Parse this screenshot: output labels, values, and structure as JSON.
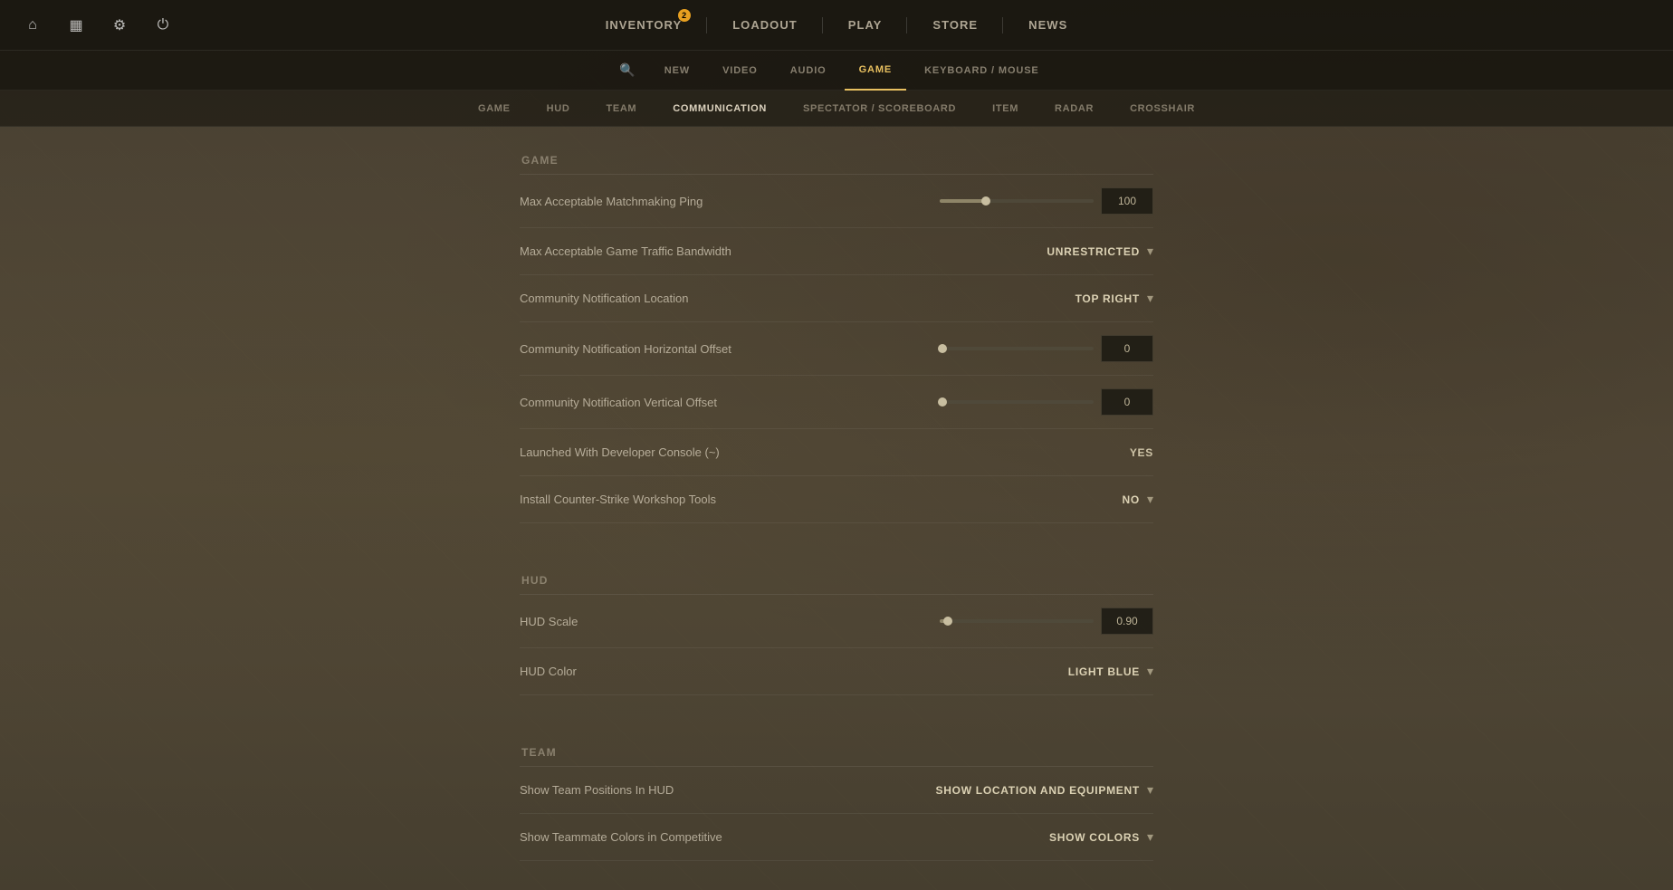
{
  "topNav": {
    "icons": [
      {
        "name": "home-icon",
        "symbol": "⌂"
      },
      {
        "name": "display-icon",
        "symbol": "▦"
      },
      {
        "name": "settings-icon",
        "symbol": "⚙"
      },
      {
        "name": "power-icon",
        "symbol": "⏻"
      }
    ],
    "links": [
      {
        "label": "INVENTORY",
        "badge": "2",
        "active": false
      },
      {
        "label": "LOADOUT",
        "badge": null,
        "active": false
      },
      {
        "label": "PLAY",
        "badge": null,
        "active": false
      },
      {
        "label": "STORE",
        "badge": null,
        "active": false
      },
      {
        "label": "NEWS",
        "badge": null,
        "active": false
      }
    ]
  },
  "secondaryNav": {
    "searchPlaceholder": "Search",
    "links": [
      {
        "label": "NEW",
        "active": false
      },
      {
        "label": "VIDEO",
        "active": false
      },
      {
        "label": "AUDIO",
        "active": false
      },
      {
        "label": "GAME",
        "active": true
      },
      {
        "label": "KEYBOARD / MOUSE",
        "active": false
      }
    ]
  },
  "thirdNav": {
    "links": [
      {
        "label": "GAME",
        "active": false
      },
      {
        "label": "HUD",
        "active": false
      },
      {
        "label": "TEAM",
        "active": false
      },
      {
        "label": "COMMUNICATION",
        "active": true
      },
      {
        "label": "SPECTATOR / SCOREBOARD",
        "active": false
      },
      {
        "label": "ITEM",
        "active": false
      },
      {
        "label": "RADAR",
        "active": false
      },
      {
        "label": "CROSSHAIR",
        "active": false
      }
    ]
  },
  "sections": {
    "game": {
      "title": "Game",
      "settings": [
        {
          "label": "Max Acceptable Matchmaking Ping",
          "controlType": "slider-value",
          "sliderPercent": 30,
          "value": "100"
        },
        {
          "label": "Max Acceptable Game Traffic Bandwidth",
          "controlType": "dropdown",
          "value": "UNRESTRICTED"
        },
        {
          "label": "Community Notification Location",
          "controlType": "dropdown",
          "value": "TOP RIGHT"
        },
        {
          "label": "Community Notification Horizontal Offset",
          "controlType": "slider-value",
          "sliderPercent": 2,
          "value": "0"
        },
        {
          "label": "Community Notification Vertical Offset",
          "controlType": "slider-value",
          "sliderPercent": 2,
          "value": "0"
        },
        {
          "label": "Launched With Developer Console (~)",
          "controlType": "static",
          "value": "YES"
        },
        {
          "label": "Install Counter-Strike Workshop Tools",
          "controlType": "dropdown",
          "value": "NO"
        }
      ]
    },
    "hud": {
      "title": "Hud",
      "settings": [
        {
          "label": "HUD Scale",
          "controlType": "slider-value",
          "sliderPercent": 5,
          "value": "0.90"
        },
        {
          "label": "HUD Color",
          "controlType": "dropdown",
          "value": "LIGHT BLUE"
        }
      ]
    },
    "team": {
      "title": "Team",
      "settings": [
        {
          "label": "Show Team Positions In HUD",
          "controlType": "dropdown",
          "value": "SHOW LOCATION AND EQUIPMENT"
        },
        {
          "label": "Show Teammate Colors in Competitive",
          "controlType": "dropdown",
          "value": "SHOW COLORS"
        }
      ]
    }
  }
}
